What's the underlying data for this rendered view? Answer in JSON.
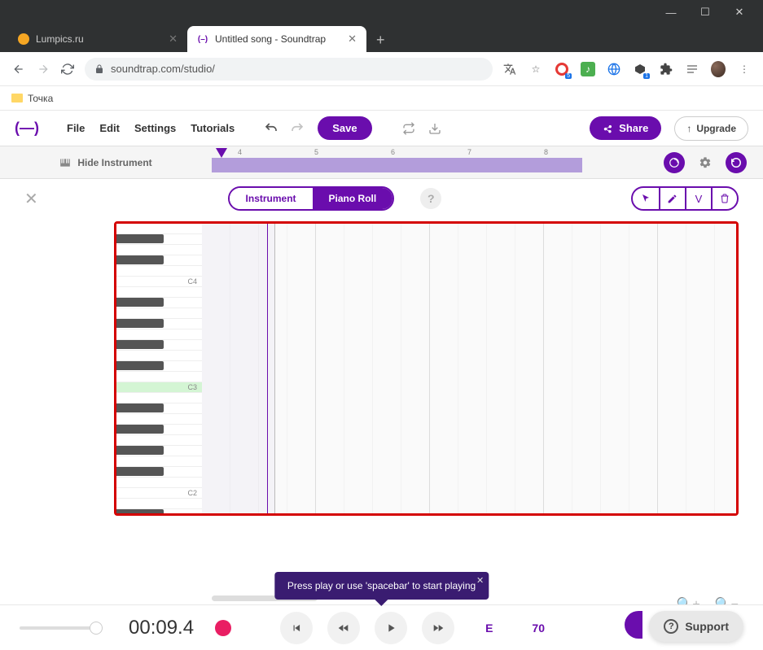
{
  "window": {
    "minimize": "—",
    "maximize": "☐",
    "close": "✕"
  },
  "tabs": [
    {
      "title": "Lumpics.ru",
      "favicon": "#f5a623",
      "active": false
    },
    {
      "title": "Untitled song - Soundtrap",
      "favicon": "purple-paren",
      "active": true
    }
  ],
  "url": "soundtrap.com/studio/",
  "bookmarks": {
    "item1": "Точка"
  },
  "menu": {
    "file": "File",
    "edit": "Edit",
    "settings": "Settings",
    "tutorials": "Tutorials"
  },
  "toolbar": {
    "save": "Save",
    "share": "Share",
    "upgrade": "Upgrade"
  },
  "overview": {
    "hide_instrument": "Hide Instrument",
    "markers": [
      "4",
      "5",
      "6",
      "7",
      "8"
    ]
  },
  "editor": {
    "seg_instrument": "Instrument",
    "seg_pianoroll": "Piano Roll",
    "velocity_label": "V"
  },
  "piano": {
    "labels": {
      "C4": "C4",
      "C3": "C3",
      "C2": "C2"
    }
  },
  "tooltip": {
    "text": "Press play or use 'spacebar' to start playing"
  },
  "transport": {
    "time": "00:09.4",
    "key": "E",
    "tempo": "70"
  },
  "support": {
    "label": "Support"
  }
}
